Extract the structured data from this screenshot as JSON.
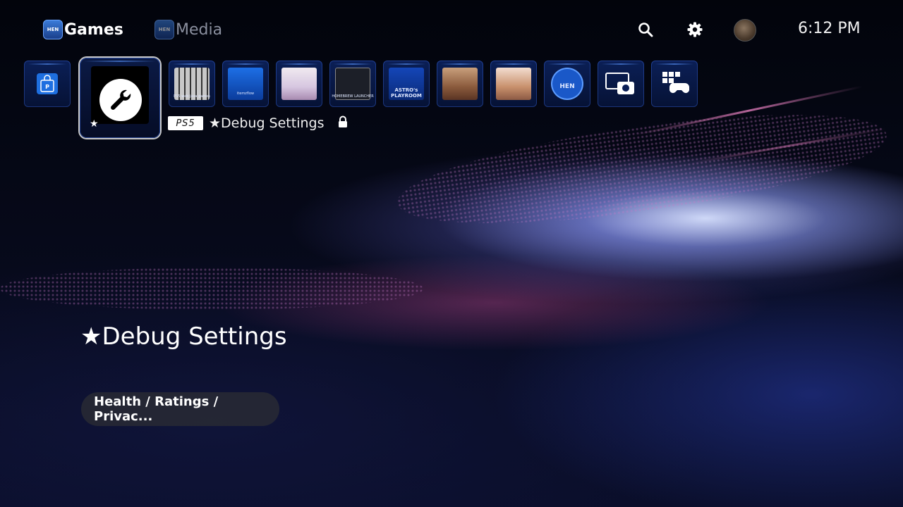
{
  "nav": {
    "tabs": [
      {
        "label": "Games",
        "icon": "hen-icon",
        "active": true
      },
      {
        "label": "Media",
        "icon": "hen-icon",
        "active": false
      }
    ],
    "hen_badge_text": "HEN",
    "right_icons": [
      "search-icon",
      "gear-icon",
      "avatar"
    ],
    "time": "6:12 PM"
  },
  "tiles": [
    {
      "name": "playstation-store",
      "icon": "ps-store-icon"
    },
    {
      "name": "debug-settings",
      "icon": "wrench-icon",
      "focused": true
    },
    {
      "name": "ps5-web-java-games",
      "label": "PS5 web java games"
    },
    {
      "name": "itemzflow",
      "label": "itemzflow"
    },
    {
      "name": "anime-game-1"
    },
    {
      "name": "homebrew-launcher",
      "label": "HOMEBREW LAUNCHER"
    },
    {
      "name": "astros-playroom",
      "label": "ASTRO's PLAYROOM"
    },
    {
      "name": "anime-game-2"
    },
    {
      "name": "anime-game-3"
    },
    {
      "name": "hen-app",
      "label": "HEN"
    },
    {
      "name": "media-gallery",
      "icon": "camera-icon"
    },
    {
      "name": "game-library",
      "icon": "library-icon"
    }
  ],
  "focused": {
    "platform_badge": "PS5",
    "title_small": "★Debug Settings",
    "title_large": "★Debug Settings",
    "info_pill": "Health / Ratings / Privac..."
  },
  "colors": {
    "accent": "#2f6fd8",
    "tile_bg": "#0b1f56",
    "pill_bg": "#282a34"
  }
}
